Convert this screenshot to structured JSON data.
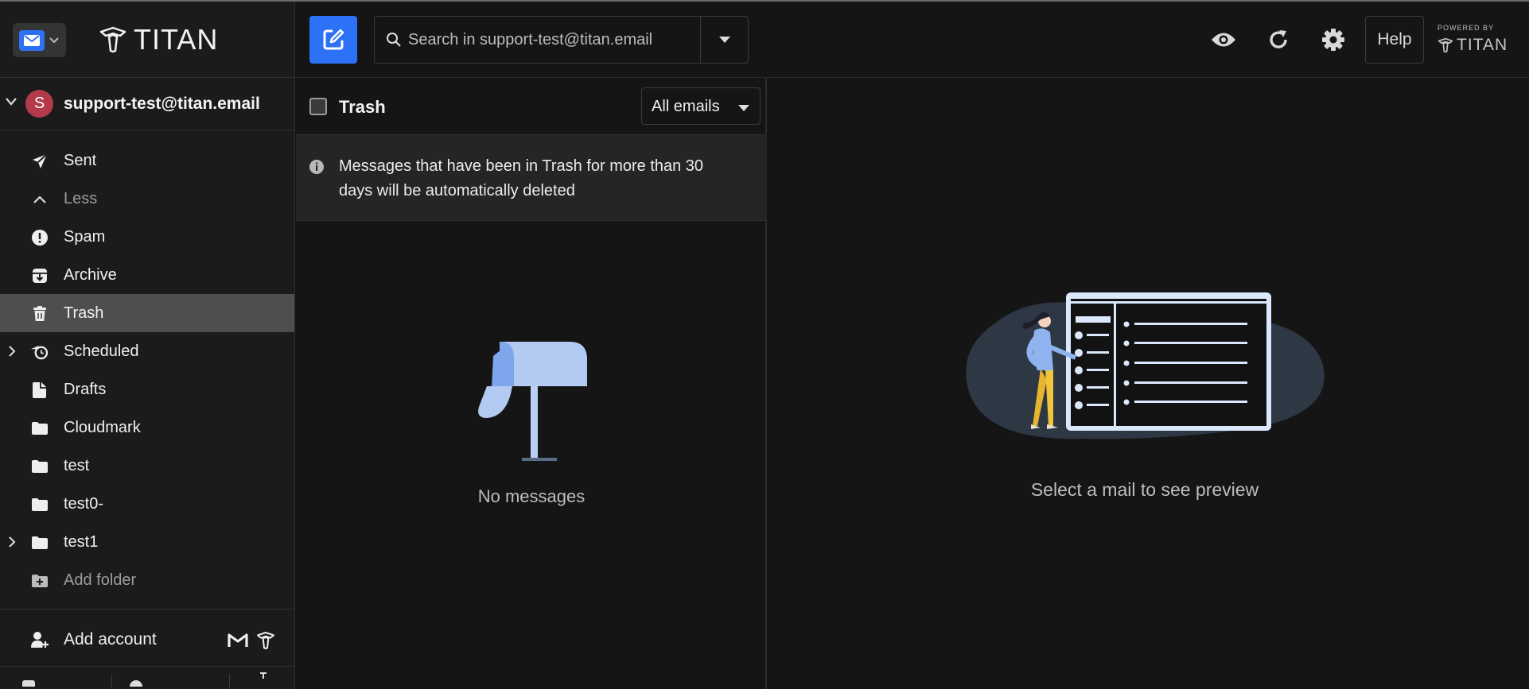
{
  "app": {
    "brand": "TITAN",
    "powered_by": "POWERED BY",
    "powered_brand": "TITAN"
  },
  "account": {
    "initial": "S",
    "email": "support-test@titan.email",
    "avatar_color": "#b33a4a"
  },
  "sidebar": {
    "folders": [
      {
        "label": "Sent",
        "icon": "send-icon"
      },
      {
        "label": "Less",
        "icon": "chevron-up-icon"
      },
      {
        "label": "Spam",
        "icon": "spam-icon"
      },
      {
        "label": "Archive",
        "icon": "archive-icon"
      },
      {
        "label": "Trash",
        "icon": "trash-icon",
        "active": true
      },
      {
        "label": "Scheduled",
        "icon": "scheduled-icon",
        "expandable": true
      },
      {
        "label": "Drafts",
        "icon": "drafts-icon"
      },
      {
        "label": "Cloudmark",
        "icon": "folder-icon"
      },
      {
        "label": "test",
        "icon": "folder-icon"
      },
      {
        "label": "test0-",
        "icon": "folder-icon"
      },
      {
        "label": "test1",
        "icon": "folder-icon",
        "expandable": true
      },
      {
        "label": "Add folder",
        "icon": "add-folder-icon"
      }
    ],
    "add_account": "Add account"
  },
  "search": {
    "placeholder": "Search in support-test@titan.email"
  },
  "toolbar": {
    "help_label": "Help"
  },
  "list": {
    "title": "Trash",
    "filter": "All emails",
    "notice": "Messages that have been in Trash for more than 30 days will be automatically deleted",
    "empty": "No messages"
  },
  "preview": {
    "empty": "Select a mail to see preview"
  },
  "colors": {
    "accent": "#2d72f6",
    "active_row": "#4e4e4e",
    "background": "#151515"
  }
}
